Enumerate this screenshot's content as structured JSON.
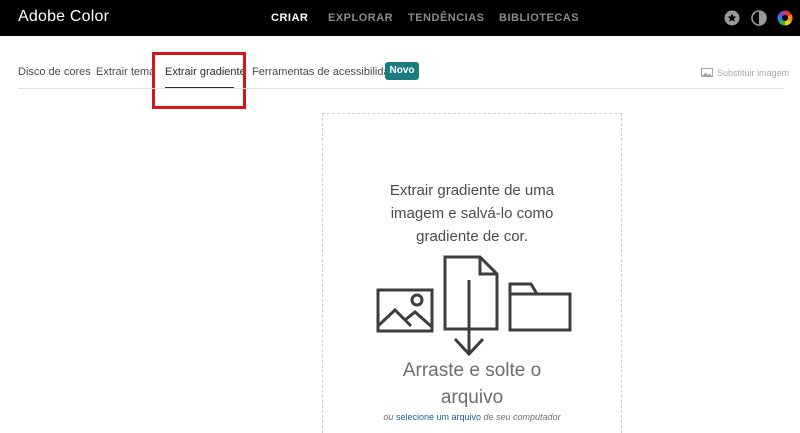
{
  "app": {
    "title": "Adobe Color"
  },
  "topnav": {
    "items": [
      "CRIAR",
      "EXPLORAR",
      "TENDÊNCIAS",
      "BIBLIOTECAS"
    ],
    "active": "CRIAR"
  },
  "top_icons": [
    "star-badge-icon",
    "contrast-theme-icon",
    "color-wheel-icon"
  ],
  "subnav": {
    "tabs": [
      "Disco de cores",
      "Extrair tema",
      "Extrair gradiente",
      "Ferramentas de acessibilidade"
    ],
    "active": "Extrair gradiente",
    "badge": "Novo",
    "replace_image": "Substituir imagem"
  },
  "dropzone": {
    "instruction_lines": [
      "Extrair gradiente de uma",
      "imagem e salvá-lo como",
      "gradiente de cor."
    ],
    "drag_lines": [
      "Arraste e solte o",
      "arquivo"
    ],
    "select_prefix": "ou",
    "select_link": "selecione um arquivo",
    "select_suffix": "de seu computador"
  },
  "colors": {
    "topbar_bg": "#000000",
    "badge_bg": "#1a7b80",
    "highlight_border": "#d7141a",
    "link": "#1f5fa6"
  }
}
